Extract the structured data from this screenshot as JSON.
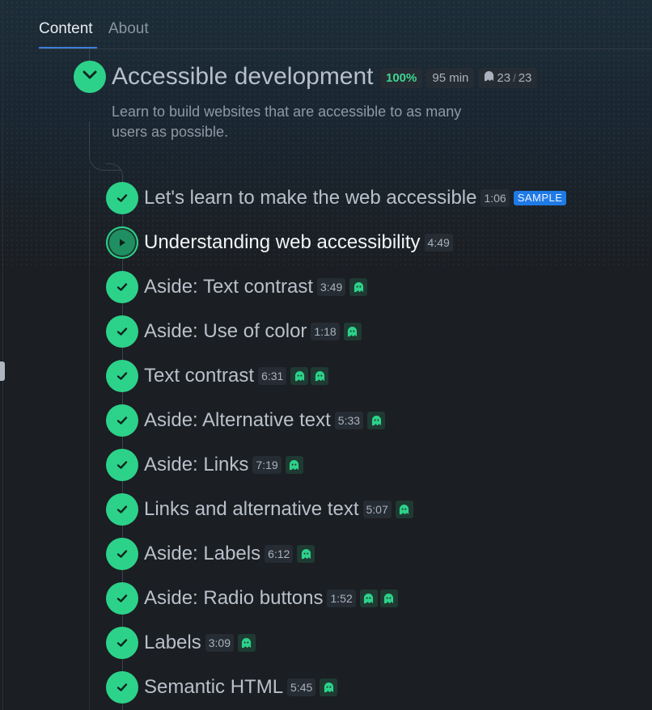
{
  "tabs": [
    {
      "label": "Content",
      "active": true
    },
    {
      "label": "About",
      "active": false
    }
  ],
  "section": {
    "title": "Accessible development",
    "progress": "100%",
    "duration": "95 min",
    "challenges_done": "23",
    "challenges_sep": "/",
    "challenges_total": "23",
    "description": "Learn to build websites that are accessible to as many users as possible."
  },
  "lessons": [
    {
      "title": "Let's learn to make the web accessible",
      "duration": "1:06",
      "badge": "SAMPLE",
      "ghosts": 0,
      "current": false
    },
    {
      "title": "Understanding web accessibility",
      "duration": "4:49",
      "ghosts": 0,
      "current": true
    },
    {
      "title": "Aside: Text contrast",
      "duration": "3:49",
      "ghosts": 1
    },
    {
      "title": "Aside: Use of color",
      "duration": "1:18",
      "ghosts": 1
    },
    {
      "title": "Text contrast",
      "duration": "6:31",
      "ghosts": 2
    },
    {
      "title": "Aside: Alternative text",
      "duration": "5:33",
      "ghosts": 1
    },
    {
      "title": "Aside: Links",
      "duration": "7:19",
      "ghosts": 1
    },
    {
      "title": "Links and alternative text",
      "duration": "5:07",
      "ghosts": 1
    },
    {
      "title": "Aside: Labels",
      "duration": "6:12",
      "ghosts": 1
    },
    {
      "title": "Aside: Radio buttons",
      "duration": "1:52",
      "ghosts": 2
    },
    {
      "title": "Labels",
      "duration": "3:09",
      "ghosts": 1
    },
    {
      "title": "Semantic HTML",
      "duration": "5:45",
      "ghosts": 1
    }
  ],
  "colors": {
    "accent_green": "#2dd28a",
    "sample_blue": "#1f7ae6",
    "tab_underline": "#3d7fd9",
    "background": "#1b1e22"
  },
  "icons": {
    "section_toggle": "chevron-down-icon",
    "lesson_done": "checkmark-icon",
    "lesson_current": "play-icon",
    "challenge": "ghost-icon"
  }
}
